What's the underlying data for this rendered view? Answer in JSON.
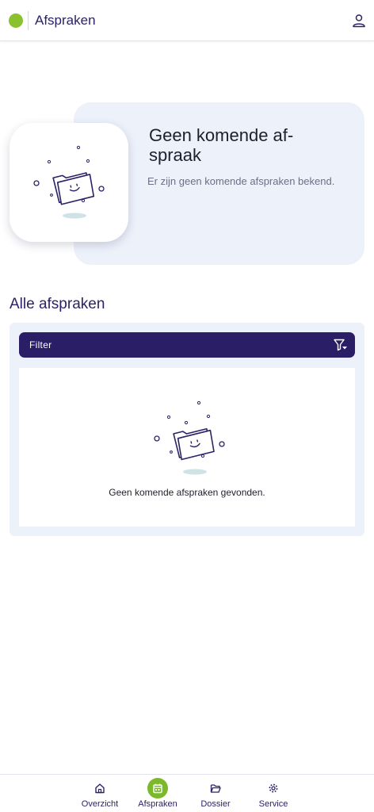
{
  "header": {
    "title": "Afspraken",
    "logo_icon": "brand-dot-icon",
    "user_icon": "user-icon",
    "brand_color": "#8bc12c"
  },
  "hero": {
    "title": "Geen komende af-spraak",
    "subtitle": "Er zijn geen komende afspraken bekend.",
    "illustration_icon": "empty-folder-icon"
  },
  "appointments": {
    "section_title": "Alle afspraken",
    "filter_label": "Filter",
    "filter_icon": "filter-icon",
    "empty_message": "Geen komende afspraken gevonden."
  },
  "bottom_nav": {
    "items": [
      {
        "label": "Overzicht",
        "icon": "home-icon",
        "active": false
      },
      {
        "label": "Afspraken",
        "icon": "calendar-icon",
        "active": true
      },
      {
        "label": "Dossier",
        "icon": "folder-icon",
        "active": false
      },
      {
        "label": "Service",
        "icon": "gear-icon",
        "active": false
      }
    ],
    "active_color": "#7cb92a"
  },
  "colors": {
    "primary": "#2a1f66",
    "panel": "#edf1fa"
  }
}
